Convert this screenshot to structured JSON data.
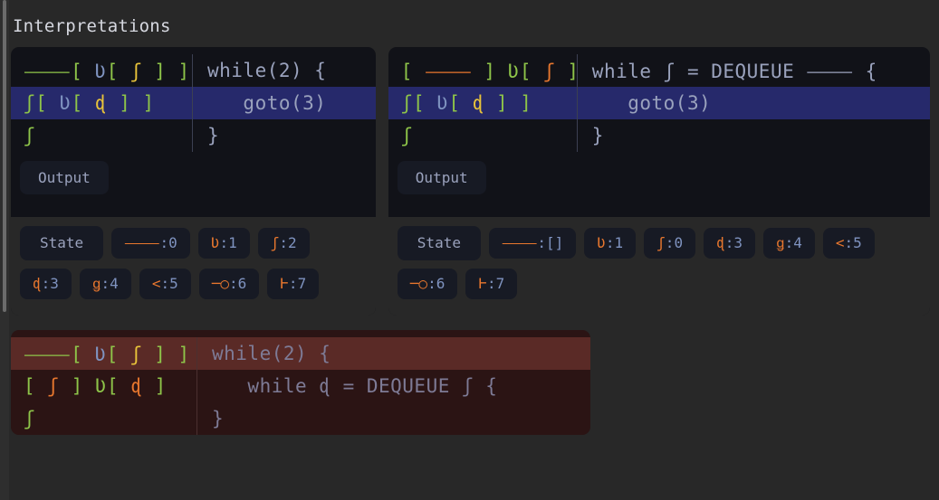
{
  "page": {
    "title": "Interpretations",
    "bg": "#282828",
    "accent_green": "#8ec449",
    "accent_orange": "#e8772e",
    "accent_yellow": "#e8c33a",
    "accent_blue": "#7f93c0",
    "highlight_blue": "#26296b",
    "highlight_red": "#5a2a26",
    "card_bg": "#111218",
    "card_err_bg": "#2b1414"
  },
  "cards": [
    {
      "id": "interp-left",
      "status": "ok",
      "lines": [
        {
          "highlight": false,
          "sym": [
            {
              "text": "⸻",
              "color": "green"
            },
            {
              "text": "[ ",
              "color": "green"
            },
            {
              "text": "Ʋ",
              "color": "blue"
            },
            {
              "text": "[ ",
              "color": "green"
            },
            {
              "text": "ʃ",
              "color": "yellow"
            },
            {
              "text": " ] ",
              "color": "green"
            },
            {
              "text": "]",
              "color": "green"
            }
          ],
          "src": "while(2) {"
        },
        {
          "highlight": true,
          "sym": [
            {
              "text": "ʃ",
              "color": "green"
            },
            {
              "text": "[ ",
              "color": "green"
            },
            {
              "text": "Ʋ",
              "color": "blue"
            },
            {
              "text": "[ ",
              "color": "green"
            },
            {
              "text": "ɖ",
              "color": "yellow"
            },
            {
              "text": " ] ",
              "color": "green"
            },
            {
              "text": "]",
              "color": "green"
            }
          ],
          "src": "   goto(3)"
        },
        {
          "highlight": false,
          "sym": [
            {
              "text": "ʃ",
              "color": "green"
            }
          ],
          "src": "}"
        }
      ],
      "output_label": "Output",
      "output_values": [],
      "state_label": "State",
      "state": [
        {
          "sym": "⸻",
          "value": "0"
        },
        {
          "sym": "Ʋ",
          "value": "1"
        },
        {
          "sym": "ʃ",
          "value": "2"
        },
        {
          "sym": "ɖ",
          "value": "3"
        },
        {
          "sym": "ǥ",
          "value": "4"
        },
        {
          "sym": "<",
          "value": "5"
        },
        {
          "sym": "─○",
          "value": "6"
        },
        {
          "sym": "Ⱶ",
          "value": "7"
        }
      ]
    },
    {
      "id": "interp-right",
      "status": "ok",
      "lines": [
        {
          "highlight": false,
          "sym": [
            {
              "text": "[ ",
              "color": "green"
            },
            {
              "text": "⸻",
              "color": "orange"
            },
            {
              "text": " ] ",
              "color": "green"
            },
            {
              "text": "Ʋ",
              "color": "green"
            },
            {
              "text": "[ ",
              "color": "green"
            },
            {
              "text": "ʃ",
              "color": "orange"
            },
            {
              "text": " ]",
              "color": "green"
            }
          ],
          "src": "while ʃ = DEQUEUE ⸻ {"
        },
        {
          "highlight": true,
          "sym": [
            {
              "text": "ʃ",
              "color": "green"
            },
            {
              "text": "[ ",
              "color": "green"
            },
            {
              "text": "Ʋ",
              "color": "blue"
            },
            {
              "text": "[ ",
              "color": "green"
            },
            {
              "text": "ɖ",
              "color": "yellow"
            },
            {
              "text": " ] ",
              "color": "green"
            },
            {
              "text": "]",
              "color": "green"
            }
          ],
          "src": "   goto(3)"
        },
        {
          "highlight": false,
          "sym": [
            {
              "text": "ʃ",
              "color": "green"
            }
          ],
          "src": "}"
        }
      ],
      "output_label": "Output",
      "output_values": [],
      "state_label": "State",
      "state": [
        {
          "sym": "⸻",
          "value": "[]"
        },
        {
          "sym": "Ʋ",
          "value": "1"
        },
        {
          "sym": "ʃ",
          "value": "0"
        },
        {
          "sym": "ɖ",
          "value": "3"
        },
        {
          "sym": "ǥ",
          "value": "4"
        },
        {
          "sym": "<",
          "value": "5"
        },
        {
          "sym": "─○",
          "value": "6"
        },
        {
          "sym": "Ⱶ",
          "value": "7"
        }
      ]
    }
  ],
  "error_card": {
    "id": "interp-error",
    "status": "error",
    "lines": [
      {
        "highlight": true,
        "sym": [
          {
            "text": "⸻",
            "color": "green"
          },
          {
            "text": "[ ",
            "color": "green"
          },
          {
            "text": "Ʋ",
            "color": "blue"
          },
          {
            "text": "[ ",
            "color": "green"
          },
          {
            "text": "ʃ",
            "color": "yellow"
          },
          {
            "text": " ] ",
            "color": "green"
          },
          {
            "text": "]",
            "color": "green"
          }
        ],
        "src": "while(2) {"
      },
      {
        "highlight": false,
        "sym": [
          {
            "text": "[ ",
            "color": "green"
          },
          {
            "text": "ʃ",
            "color": "orange"
          },
          {
            "text": " ] ",
            "color": "green"
          },
          {
            "text": "Ʋ",
            "color": "green"
          },
          {
            "text": "[ ",
            "color": "green"
          },
          {
            "text": "ɖ",
            "color": "orange"
          },
          {
            "text": " ]",
            "color": "green"
          }
        ],
        "src": "   while ɖ = DEQUEUE ʃ {"
      },
      {
        "highlight": false,
        "sym": [
          {
            "text": "ʃ",
            "color": "green"
          }
        ],
        "src": "}"
      }
    ]
  }
}
